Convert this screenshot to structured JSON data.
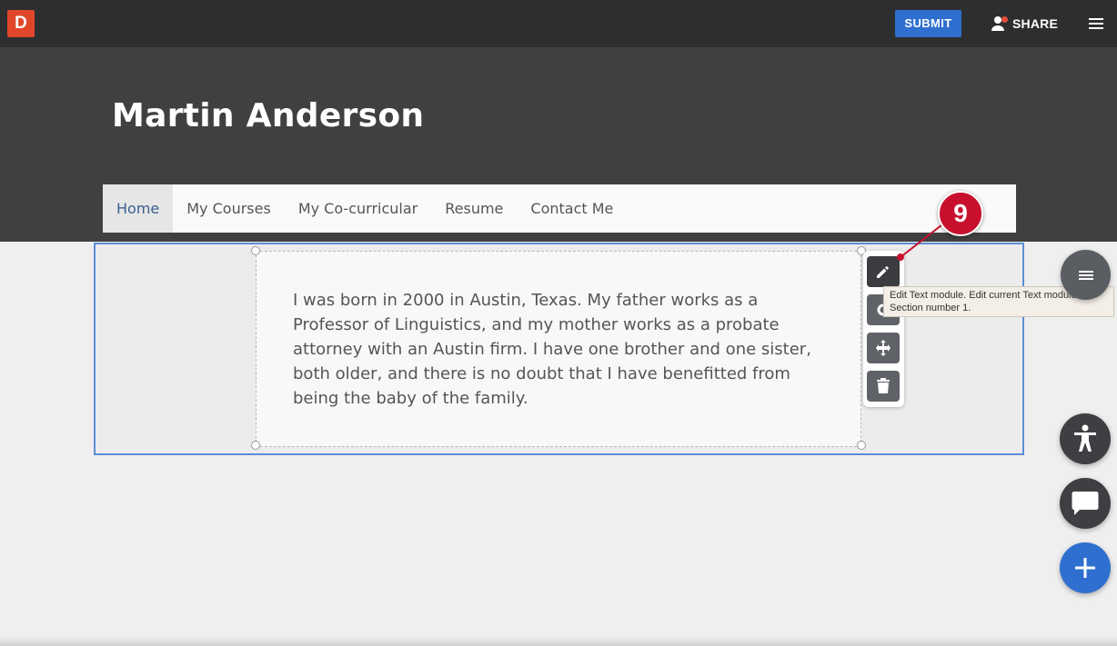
{
  "topbar": {
    "logo_letter": "D",
    "submit_label": "SUBMIT",
    "share_label": "SHARE"
  },
  "header": {
    "title": "Martin Anderson"
  },
  "nav": {
    "items": [
      {
        "label": "Home",
        "active": true
      },
      {
        "label": "My Courses",
        "active": false
      },
      {
        "label": "My Co-curricular",
        "active": false
      },
      {
        "label": "Resume",
        "active": false
      },
      {
        "label": "Contact Me",
        "active": false
      }
    ]
  },
  "module": {
    "text": "I was born in 2000 in Austin, Texas. My father works as a Professor of Linguistics, and my mother works as a probate attorney with an Austin firm. I have one brother and one sister, both older, and there is no doubt that I have benefitted from being the baby of the family."
  },
  "toolbar": {
    "tooltip": "Edit  Text module. Edit current Text module in Section number 1."
  },
  "callout": {
    "number": "9"
  },
  "colors": {
    "accent_blue": "#2f6fd0",
    "logo_red": "#e0472a",
    "callout_red": "#c8102e",
    "section_border": "#5b8ed6"
  },
  "icons": [
    "pencil-icon",
    "gear-icon",
    "move-icon",
    "trash-icon",
    "hamburger-menu-icon",
    "accessibility-icon",
    "chat-icon",
    "plus-icon",
    "person-icon"
  ]
}
